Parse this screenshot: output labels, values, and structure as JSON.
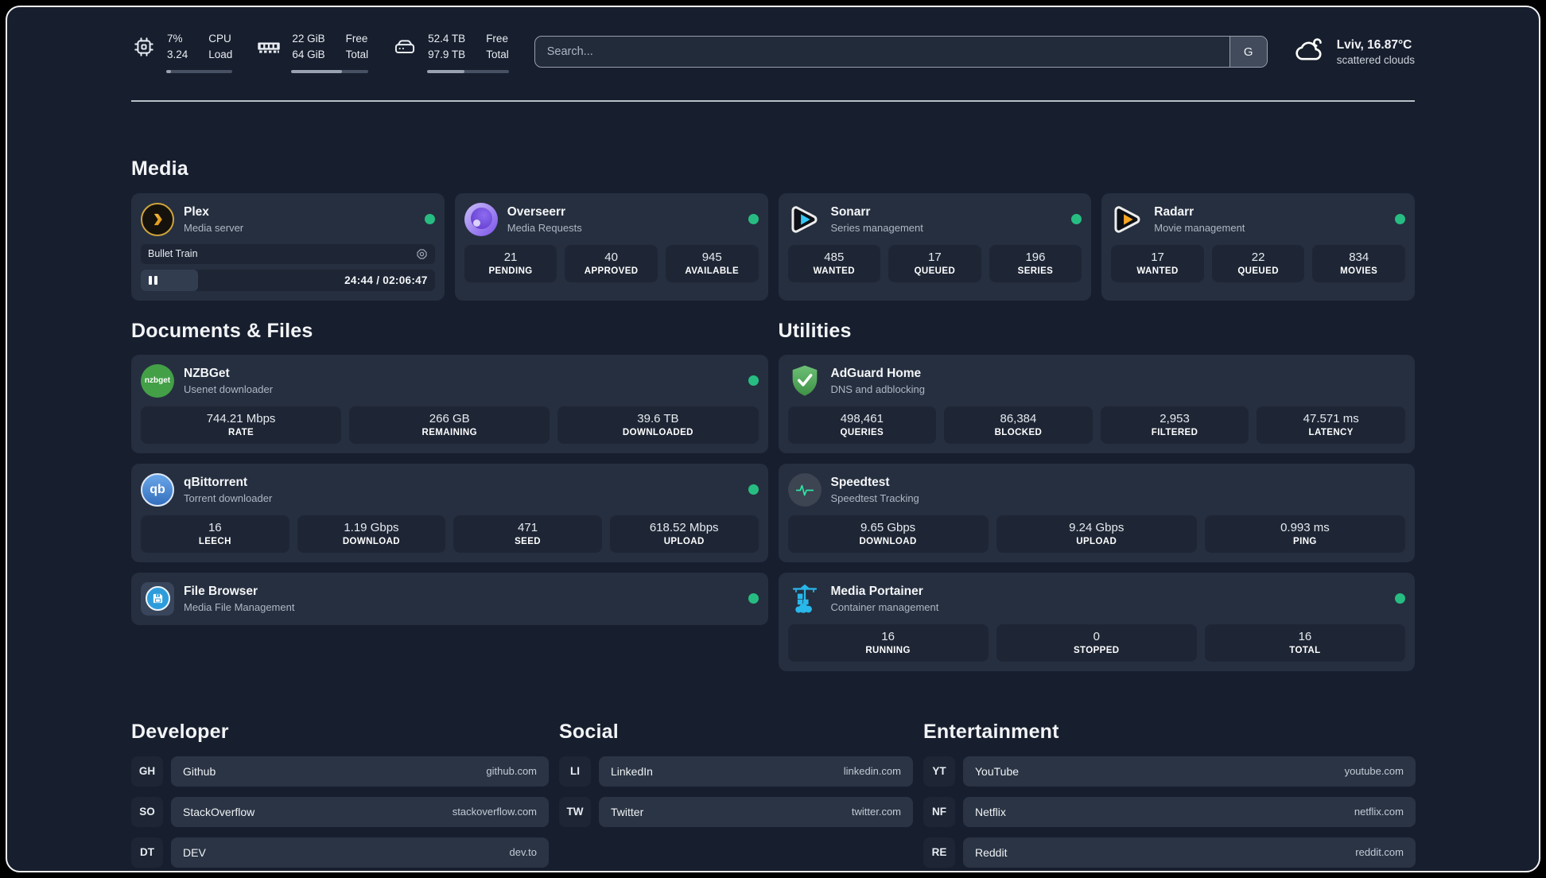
{
  "colors": {
    "status_online": "#27bd82",
    "page_bg": "#171e2d",
    "card_bg": "#262f3f",
    "tile_bg": "#1e2635",
    "accent_plex": "#e5a00d",
    "accent_sonarr": "#36c6f4",
    "accent_radarr": "#f6a623",
    "accent_nzbget": "#43a047",
    "accent_qbittorrent": "#3570bf",
    "accent_filebrowser": "#2d9cdb",
    "accent_adguard": "#5eb95e",
    "accent_speedtest": "#2fe3a1",
    "accent_portainer": "#29b8eb"
  },
  "header": {
    "cpu": {
      "value_line1": "7%",
      "value_line2": "3.24",
      "label_line1": "CPU",
      "label_line2": "Load",
      "progress_pct": 7
    },
    "memory": {
      "value_line1": "22 GiB",
      "value_line2": "64 GiB",
      "label_line1": "Free",
      "label_line2": "Total",
      "progress_pct": 66
    },
    "disk": {
      "value_line1": "52.4 TB",
      "value_line2": "97.9 TB",
      "label_line1": "Free",
      "label_line2": "Total",
      "progress_pct": 46
    },
    "search": {
      "placeholder": "Search...",
      "provider_button": "G"
    },
    "weather": {
      "location": "Lviv, 16.87°C",
      "condition": "scattered clouds"
    }
  },
  "sections": {
    "media": {
      "title": "Media",
      "apps": [
        {
          "id": "plex",
          "icon": "plex",
          "name": "Plex",
          "description": "Media server",
          "online": true,
          "now_playing": {
            "title": "Bullet Train",
            "time": "24:44 / 02:06:47",
            "progress_pct": 19.5
          }
        },
        {
          "id": "overseerr",
          "icon": "overseerr",
          "name": "Overseerr",
          "description": "Media Requests",
          "online": true,
          "stats": [
            {
              "value": "21",
              "label": "PENDING"
            },
            {
              "value": "40",
              "label": "APPROVED"
            },
            {
              "value": "945",
              "label": "AVAILABLE"
            }
          ]
        },
        {
          "id": "sonarr",
          "icon": "sonarr",
          "name": "Sonarr",
          "description": "Series management",
          "online": true,
          "stats": [
            {
              "value": "485",
              "label": "WANTED"
            },
            {
              "value": "17",
              "label": "QUEUED"
            },
            {
              "value": "196",
              "label": "SERIES"
            }
          ]
        },
        {
          "id": "radarr",
          "icon": "radarr",
          "name": "Radarr",
          "description": "Movie management",
          "online": true,
          "stats": [
            {
              "value": "17",
              "label": "WANTED"
            },
            {
              "value": "22",
              "label": "QUEUED"
            },
            {
              "value": "834",
              "label": "MOVIES"
            }
          ]
        }
      ]
    },
    "documents": {
      "title": "Documents & Files",
      "apps": [
        {
          "id": "nzbget",
          "icon": "nzbget",
          "name": "NZBGet",
          "description": "Usenet downloader",
          "online": true,
          "stats": [
            {
              "value": "744.21 Mbps",
              "label": "RATE"
            },
            {
              "value": "266 GB",
              "label": "REMAINING"
            },
            {
              "value": "39.6 TB",
              "label": "DOWNLOADED"
            }
          ]
        },
        {
          "id": "qbittorrent",
          "icon": "qbittorrent",
          "name": "qBittorrent",
          "description": "Torrent downloader",
          "online": true,
          "stats": [
            {
              "value": "16",
              "label": "LEECH"
            },
            {
              "value": "1.19 Gbps",
              "label": "DOWNLOAD"
            },
            {
              "value": "471",
              "label": "SEED"
            },
            {
              "value": "618.52 Mbps",
              "label": "UPLOAD"
            }
          ]
        },
        {
          "id": "filebrowser",
          "icon": "filebrowser",
          "name": "File Browser",
          "description": "Media File Management",
          "online": true
        }
      ]
    },
    "utilities": {
      "title": "Utilities",
      "apps": [
        {
          "id": "adguard",
          "icon": "adguard",
          "name": "AdGuard Home",
          "description": "DNS and adblocking",
          "online": false,
          "stats": [
            {
              "value": "498,461",
              "label": "QUERIES"
            },
            {
              "value": "86,384",
              "label": "BLOCKED"
            },
            {
              "value": "2,953",
              "label": "FILTERED"
            },
            {
              "value": "47.571 ms",
              "label": "LATENCY"
            }
          ]
        },
        {
          "id": "speedtest",
          "icon": "speedtest",
          "name": "Speedtest",
          "description": "Speedtest Tracking",
          "online": false,
          "stats": [
            {
              "value": "9.65 Gbps",
              "label": "DOWNLOAD"
            },
            {
              "value": "9.24 Gbps",
              "label": "UPLOAD"
            },
            {
              "value": "0.993 ms",
              "label": "PING"
            }
          ]
        },
        {
          "id": "portainer",
          "icon": "portainer",
          "name": "Media Portainer",
          "description": "Container management",
          "online": true,
          "stats": [
            {
              "value": "16",
              "label": "RUNNING"
            },
            {
              "value": "0",
              "label": "STOPPED"
            },
            {
              "value": "16",
              "label": "TOTAL"
            }
          ]
        }
      ]
    }
  },
  "link_sections": [
    {
      "id": "developer",
      "title": "Developer",
      "links": [
        {
          "abbr": "GH",
          "name": "Github",
          "url": "github.com"
        },
        {
          "abbr": "SO",
          "name": "StackOverflow",
          "url": "stackoverflow.com"
        },
        {
          "abbr": "DT",
          "name": "DEV",
          "url": "dev.to"
        }
      ]
    },
    {
      "id": "social",
      "title": "Social",
      "links": [
        {
          "abbr": "LI",
          "name": "LinkedIn",
          "url": "linkedin.com"
        },
        {
          "abbr": "TW",
          "name": "Twitter",
          "url": "twitter.com"
        }
      ]
    },
    {
      "id": "entertainment",
      "title": "Entertainment",
      "links": [
        {
          "abbr": "YT",
          "name": "YouTube",
          "url": "youtube.com"
        },
        {
          "abbr": "NF",
          "name": "Netflix",
          "url": "netflix.com"
        },
        {
          "abbr": "RE",
          "name": "Reddit",
          "url": "reddit.com"
        }
      ]
    }
  ]
}
